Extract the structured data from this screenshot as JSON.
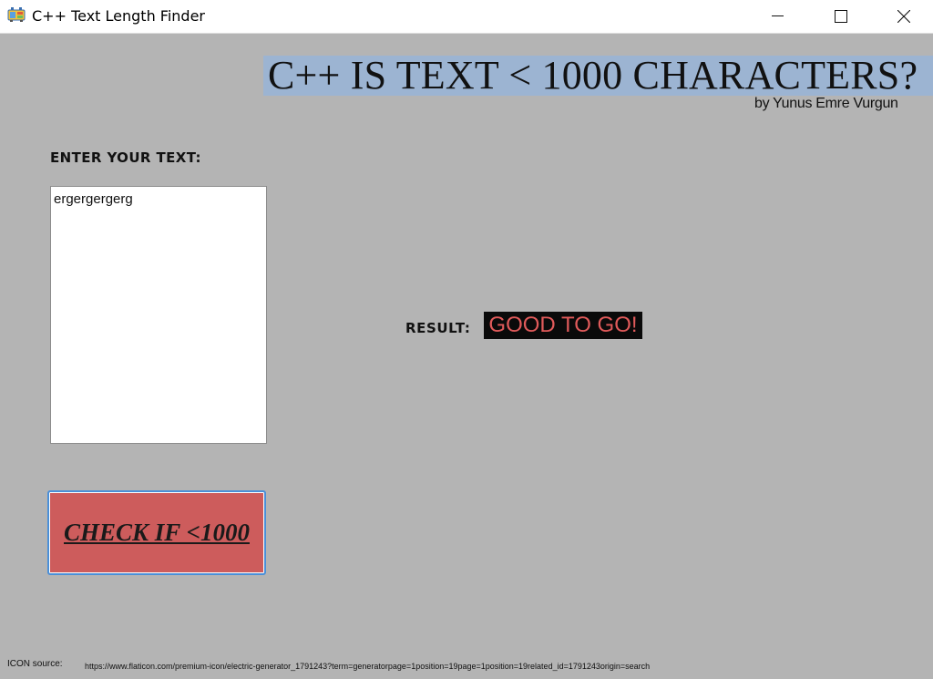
{
  "window": {
    "title": "C++ Text Length Finder",
    "icon": "electric-generator-icon"
  },
  "header": {
    "banner": "C++ IS TEXT < 1000 CHARACTERS?",
    "byline": "by Yunus Emre Vurgun"
  },
  "input": {
    "label": "ENTER YOUR TEXT:",
    "value": "ergergergerg"
  },
  "result": {
    "label": "RESULT:",
    "value": "GOOD TO GO!"
  },
  "actions": {
    "check_label": "CHECK IF <1000"
  },
  "footer": {
    "label": "ICON source:",
    "url": "https://www.flaticon.com/premium-icon/electric-generator_1791243?term=generatorpage=1position=19page=1position=19related_id=1791243origin=search"
  },
  "colors": {
    "background": "#b4b4b4",
    "banner": "#9cb4d2",
    "result_bg": "#0a0a0a",
    "result_text": "#e05a5a",
    "button_bg": "#cd5c5c",
    "button_border": "#4a8fd8"
  }
}
